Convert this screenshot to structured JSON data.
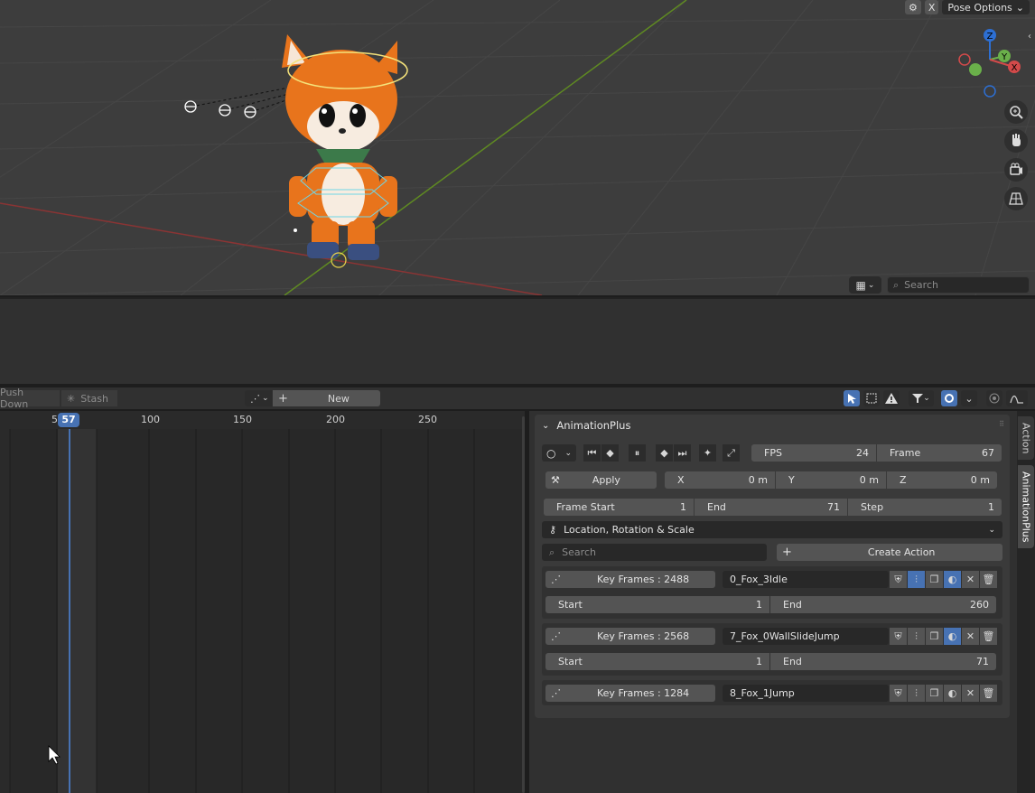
{
  "viewport": {
    "pose_options_label": "Pose Options",
    "x_label": "X",
    "search_placeholder": "Search",
    "gizmo_axes": {
      "z": "Z",
      "y": "Y",
      "x": "X"
    }
  },
  "action_header": {
    "push_down_label": "Push Down",
    "stash_label": "Stash",
    "new_label": "New"
  },
  "timeline": {
    "tick_labels": [
      "5",
      "100",
      "150",
      "200",
      "250"
    ],
    "current_frame": "57"
  },
  "panel": {
    "title": "AnimationPlus",
    "fps_label": "FPS",
    "fps_value": "24",
    "frame_label": "Frame",
    "frame_value": "67",
    "apply_label": "Apply",
    "x_label": "X",
    "x_value": "0 m",
    "y_label": "Y",
    "y_value": "0 m",
    "z_label": "Z",
    "z_value": "0 m",
    "frame_start_label": "Frame Start",
    "frame_start_value": "1",
    "end_label": "End",
    "end_value": "71",
    "step_label": "Step",
    "step_value": "1",
    "mode_label": "Location, Rotation & Scale",
    "search_placeholder": "Search",
    "create_action_label": "Create Action",
    "actions": [
      {
        "keyframes": "Key Frames : 2488",
        "name": "0_Fox_3Idle",
        "start_label": "Start",
        "start": "1",
        "end_label": "End",
        "end": "260"
      },
      {
        "keyframes": "Key Frames : 2568",
        "name": "7_Fox_0WallSlideJump",
        "start_label": "Start",
        "start": "1",
        "end_label": "End",
        "end": "71"
      },
      {
        "keyframes": "Key Frames : 1284",
        "name": "8_Fox_1Jump"
      }
    ]
  },
  "tabs": {
    "action": "Action",
    "animationplus": "AnimationPlus"
  },
  "colors": {
    "accent_blue": "#4772b3",
    "fox_orange": "#e8741c",
    "grid_green": "#6a8f2a",
    "grid_red": "#a03a3a"
  }
}
